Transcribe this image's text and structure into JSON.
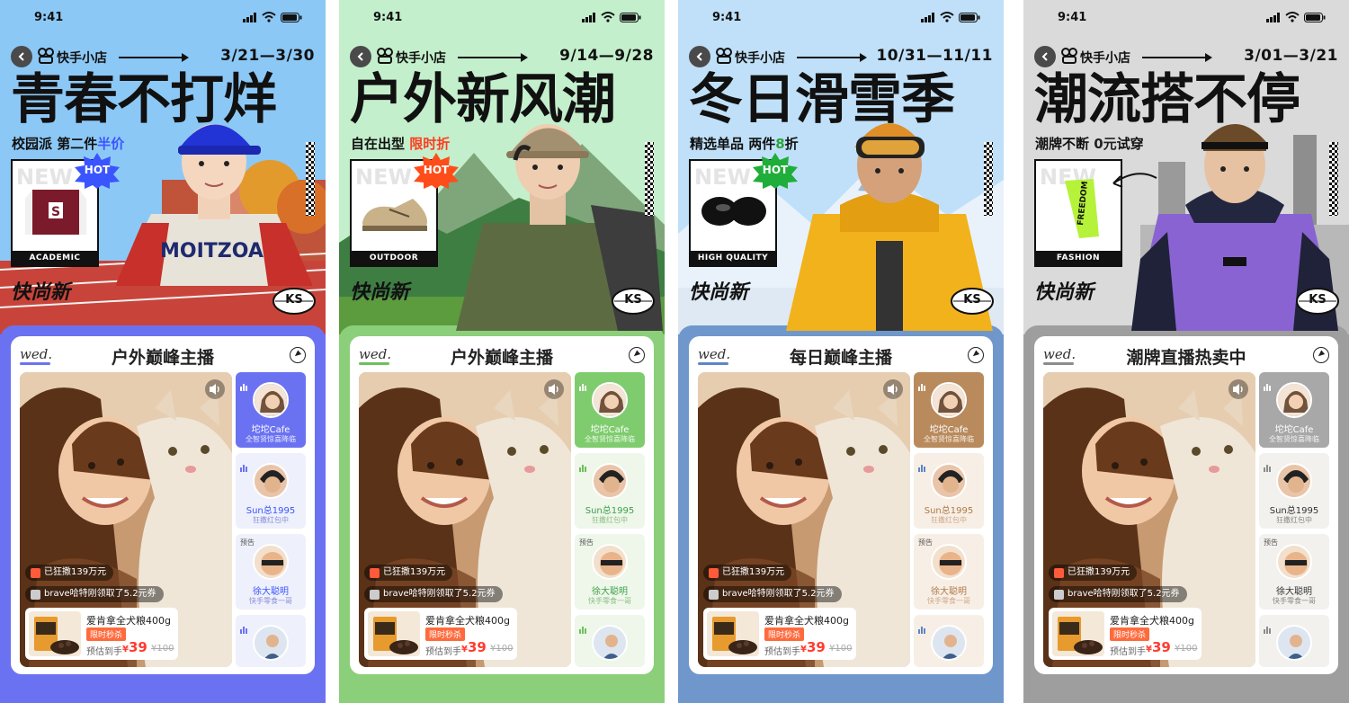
{
  "status": {
    "time": "9:41"
  },
  "common": {
    "brand": "快手小店",
    "logo": "快尚新",
    "badge": "KS",
    "hot": "HOT",
    "new_word": "NEW",
    "wed": "wed.",
    "video": {
      "raised": "已狂撒139万元",
      "claimed": "brave哈特刚领取了5.2元券",
      "product_name": "爱肯拿全犬粮400g",
      "product_tag": "限时秒杀",
      "estimate": "预估到手",
      "price_now": "39",
      "price_old": "¥100"
    },
    "streamers": [
      {
        "name": "坨坨Cafe",
        "sub": "全智贤惊喜降临",
        "pre": ""
      },
      {
        "name": "Sun总1995",
        "sub": "狂撒红包中",
        "pre": ""
      },
      {
        "name": "徐大聪明",
        "sub": "快手零食一哥",
        "pre": "预告"
      },
      {
        "name": "",
        "sub": "",
        "pre": ""
      }
    ]
  },
  "phones": [
    {
      "bg": "#8bc7f5",
      "bottom_bg": "#6b72f2",
      "accent": "#6b72f2",
      "side_active": "#6b72f2",
      "dates": "3/21—3/30",
      "headline": "青春不打烊",
      "sub_a": "校园派 第二件",
      "sub_hl": "半价",
      "sub_b": "",
      "hl_color": "#3a55ff",
      "product_label": "ACADEMIC",
      "hot_color": "#3a55ff",
      "panel_title": "户外巅峰主播",
      "name_color": "#3a55ff",
      "sub_color": "#8a8fd6"
    },
    {
      "bg": "#bfeec8",
      "bottom_bg": "#8ccf7a",
      "accent": "#6fbf5e",
      "side_active": "#7fcc6e",
      "dates": "9/14—9/28",
      "headline": "户外新风潮",
      "sub_a": "自在出型 ",
      "sub_hl": "限时折",
      "sub_b": "",
      "hl_color": "#ff3b1e",
      "product_label": "OUTDOOR",
      "hot_color": "#ff4d1a",
      "panel_title": "户外巅峰主播",
      "name_color": "#3da24a",
      "sub_color": "#8dbf85"
    },
    {
      "bg": "#bcdff7",
      "bottom_bg": "#6f97cc",
      "accent": "#5d86c4",
      "side_active": "#b98a5c",
      "dates": "10/31—11/11",
      "headline": "冬日滑雪季",
      "sub_a": "精选单品 两件",
      "sub_hl": "8",
      "sub_b": "折",
      "hl_color": "#2aa63c",
      "product_label": "HIGH QUALITY",
      "hot_color": "#1fae3a",
      "panel_title": "每日巅峰主播",
      "name_color": "#b07a48",
      "sub_color": "#cfa98a"
    },
    {
      "bg": "#d9d9d9",
      "bottom_bg": "#9e9e9e",
      "accent": "#8c8c8c",
      "side_active": "#a8a8a8",
      "dates": "3/01—3/21",
      "headline": "潮流搭不停",
      "sub_a": "潮牌不断 ",
      "sub_hl": "0元",
      "sub_b": "试穿",
      "hl_color": "#222222",
      "product_label": "FASHION",
      "hot_color": "#e3ff3a",
      "panel_title": "潮牌直播热卖中",
      "name_color": "#333333",
      "sub_color": "#888888"
    }
  ]
}
